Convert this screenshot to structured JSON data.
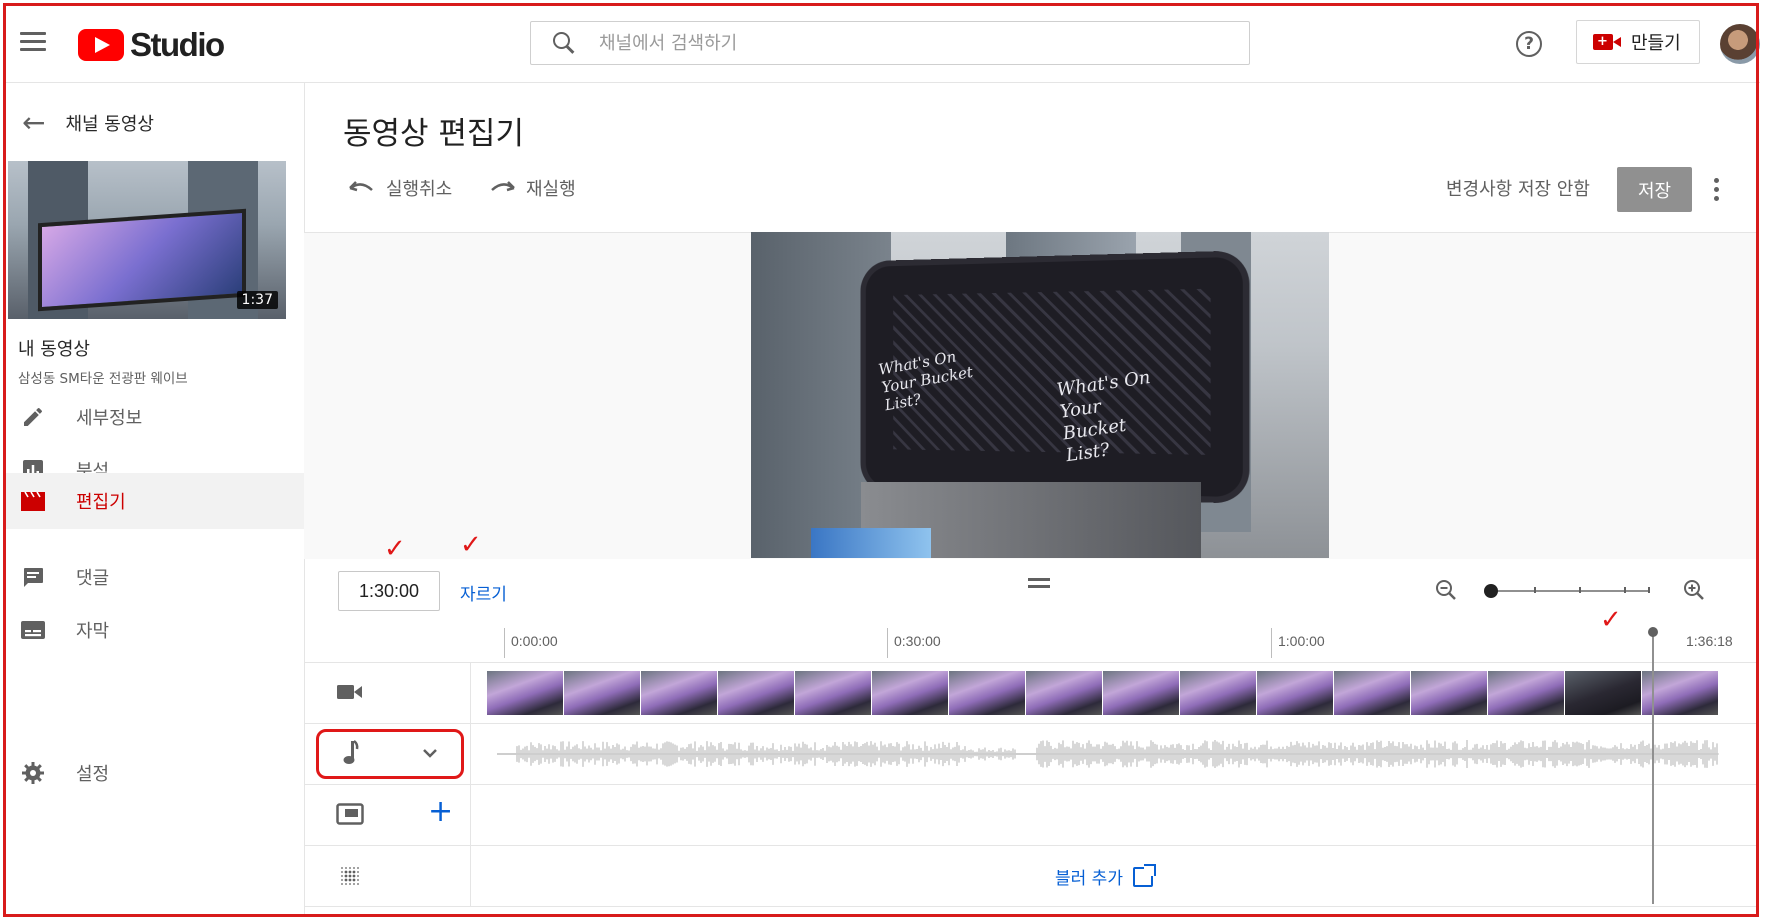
{
  "header": {
    "logo_text": "Studio",
    "search_placeholder": "채널에서 검색하기",
    "help_glyph": "?",
    "create_label": "만들기"
  },
  "sidebar": {
    "back_label": "채널 동영상",
    "video": {
      "duration": "1:37",
      "title": "내 동영상",
      "subtitle": "삼성동 SM타운 전광판 웨이브"
    },
    "items": [
      {
        "label": "세부정보",
        "icon": "pencil-icon",
        "active": false
      },
      {
        "label": "분석",
        "icon": "analytics-icon",
        "active": false
      },
      {
        "label": "편집기",
        "icon": "clapperboard-icon",
        "active": true
      },
      {
        "label": "댓글",
        "icon": "comment-icon",
        "active": false
      },
      {
        "label": "자막",
        "icon": "subtitles-icon",
        "active": false
      }
    ],
    "settings_label": "설정"
  },
  "main": {
    "title": "동영상 편집기",
    "undo_label": "실행취소",
    "redo_label": "재실행",
    "unsaved_label": "변경사항 저장 안함",
    "save_label": "저장"
  },
  "preview": {
    "board_text_left": "What's On Your Bucket List?",
    "board_text_right": "What's On Your Bucket List?"
  },
  "editor": {
    "time_value": "1:30:00",
    "trim_label": "자르기",
    "ruler": [
      "0:00:00",
      "0:30:00",
      "1:00:00",
      "1:36:18"
    ],
    "blur_label": "블러 추가",
    "playhead_time_fraction": 0.936
  },
  "colors": {
    "brand_red": "#ff0000",
    "active_red": "#cc0000",
    "link_blue": "#065fd4",
    "annotation_red": "#e01818"
  },
  "annotations": {
    "check_mark": "✓"
  }
}
